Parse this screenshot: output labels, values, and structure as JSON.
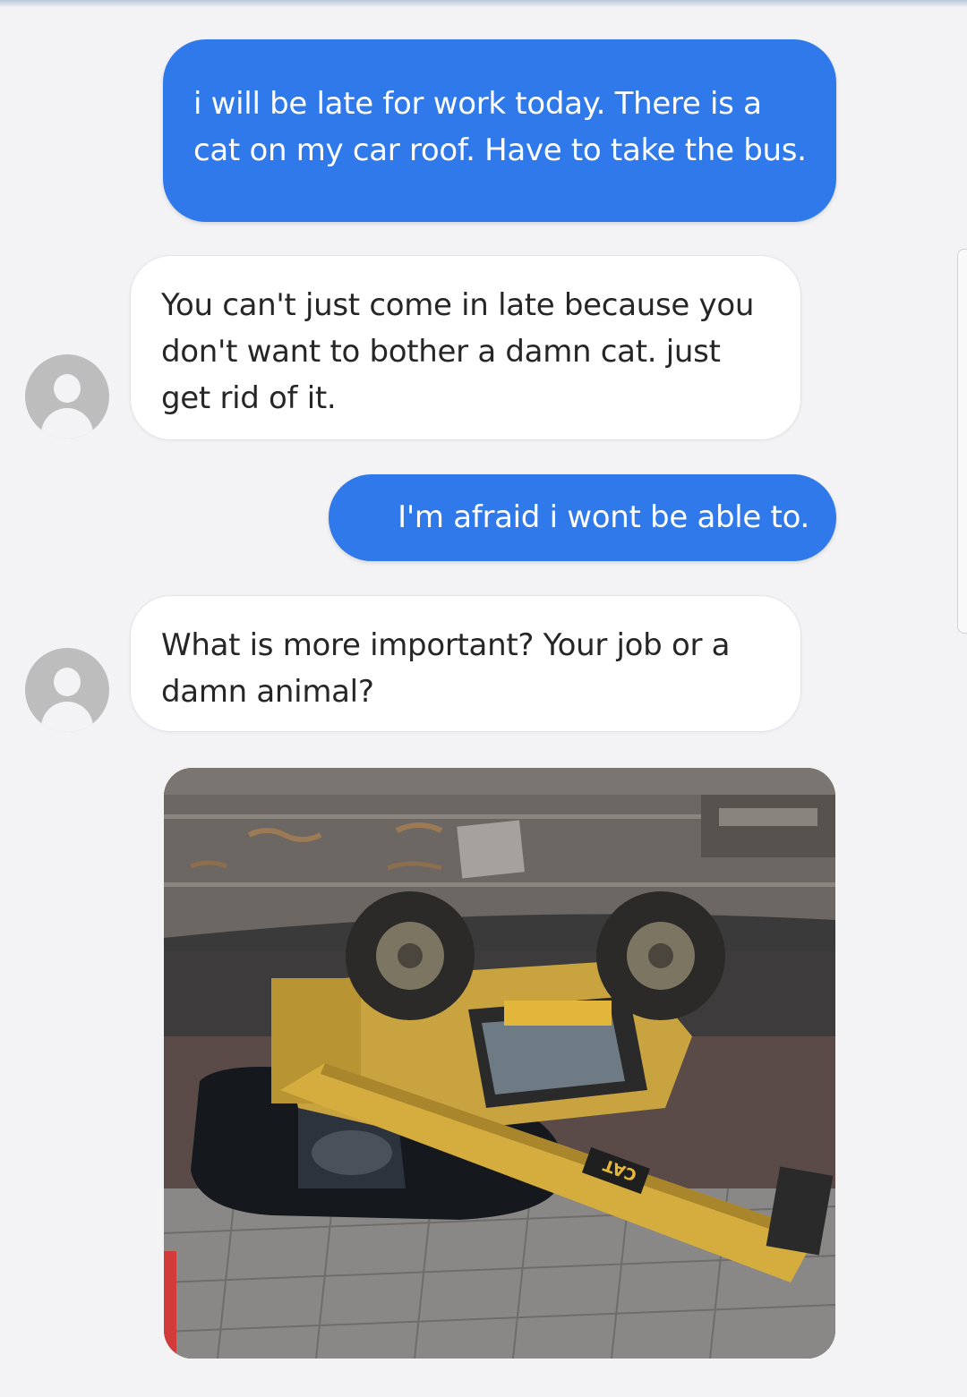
{
  "conversation": {
    "messages": [
      {
        "sender": "me",
        "text": "i will be late for work today. There is a cat on my car roof. Have to take the bus."
      },
      {
        "sender": "boss",
        "text": "You can't just come in late because you don't want to bother a damn cat. just get rid of it."
      },
      {
        "sender": "me",
        "text": "I'm afraid i wont be able to."
      },
      {
        "sender": "boss",
        "text": "What is more important? Your job or a damn animal?"
      }
    ],
    "photo": {
      "subject": "overturned telehandler crane lying on a crushed black car",
      "boom_lettering": "CAT"
    }
  },
  "colors": {
    "sent_bubble": "#2f79ea",
    "received_bubble": "#ffffff",
    "background": "#f3f3f5",
    "avatar": "#bdbdbd"
  },
  "icons": {
    "avatar": "default-user-silhouette-icon"
  }
}
